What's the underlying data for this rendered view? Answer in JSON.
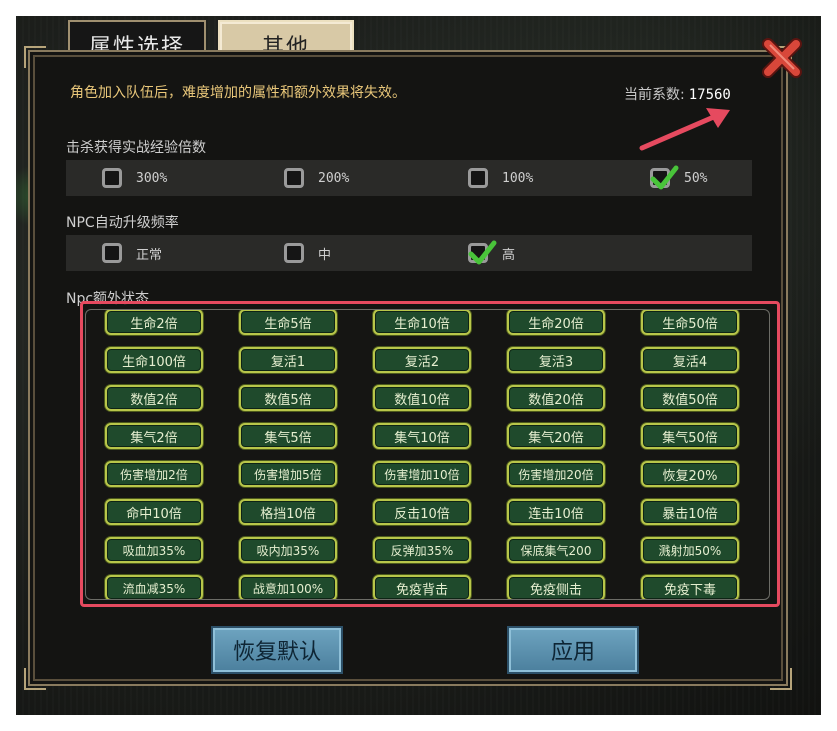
{
  "tabs": [
    {
      "label": "属性选择",
      "active": false
    },
    {
      "label": "其他",
      "active": true
    }
  ],
  "notice": "角色加入队伍后，难度增加的属性和额外效果将失效。",
  "coefficient": {
    "label": "当前系数:",
    "value": "17560"
  },
  "exp_multiplier": {
    "label": "击杀获得实战经验倍数",
    "options": [
      {
        "label": "300%",
        "checked": false
      },
      {
        "label": "200%",
        "checked": false
      },
      {
        "label": "100%",
        "checked": false
      },
      {
        "label": "50%",
        "checked": true
      }
    ]
  },
  "npc_level_rate": {
    "label": "NPC自动升级频率",
    "options": [
      {
        "label": "正常",
        "checked": false
      },
      {
        "label": "中",
        "checked": false
      },
      {
        "label": "高",
        "checked": true
      }
    ]
  },
  "npc_extra_state": {
    "label": "Npc额外状态",
    "rows": [
      [
        "生命2倍",
        "生命5倍",
        "生命10倍",
        "生命20倍",
        "生命50倍"
      ],
      [
        "生命100倍",
        "复活1",
        "复活2",
        "复活3",
        "复活4"
      ],
      [
        "数值2倍",
        "数值5倍",
        "数值10倍",
        "数值20倍",
        "数值50倍"
      ],
      [
        "集气2倍",
        "集气5倍",
        "集气10倍",
        "集气20倍",
        "集气50倍"
      ],
      [
        "伤害增加2倍",
        "伤害增加5倍",
        "伤害增加10倍",
        "伤害增加20倍",
        "恢复20%"
      ],
      [
        "命中10倍",
        "格挡10倍",
        "反击10倍",
        "连击10倍",
        "暴击10倍"
      ],
      [
        "吸血加35%",
        "吸内加35%",
        "反弹加35%",
        "保底集气200",
        "溅射加50%"
      ],
      [
        "流血减35%",
        "战意加100%",
        "免疫背击",
        "免疫侧击",
        "免疫下毒"
      ]
    ]
  },
  "buttons": {
    "reset": "恢复默认",
    "apply": "应用"
  },
  "colors": {
    "highlight": "#e64a5f",
    "state_button_fill": "#1f4a2c",
    "state_button_border": "#b8c64a",
    "notice_text": "#e9c77a",
    "check": "#49c43a"
  },
  "icons": {
    "close": "close-x-icon",
    "checkmark": "checkmark-icon",
    "annotation_arrow": "red-arrow-icon"
  }
}
